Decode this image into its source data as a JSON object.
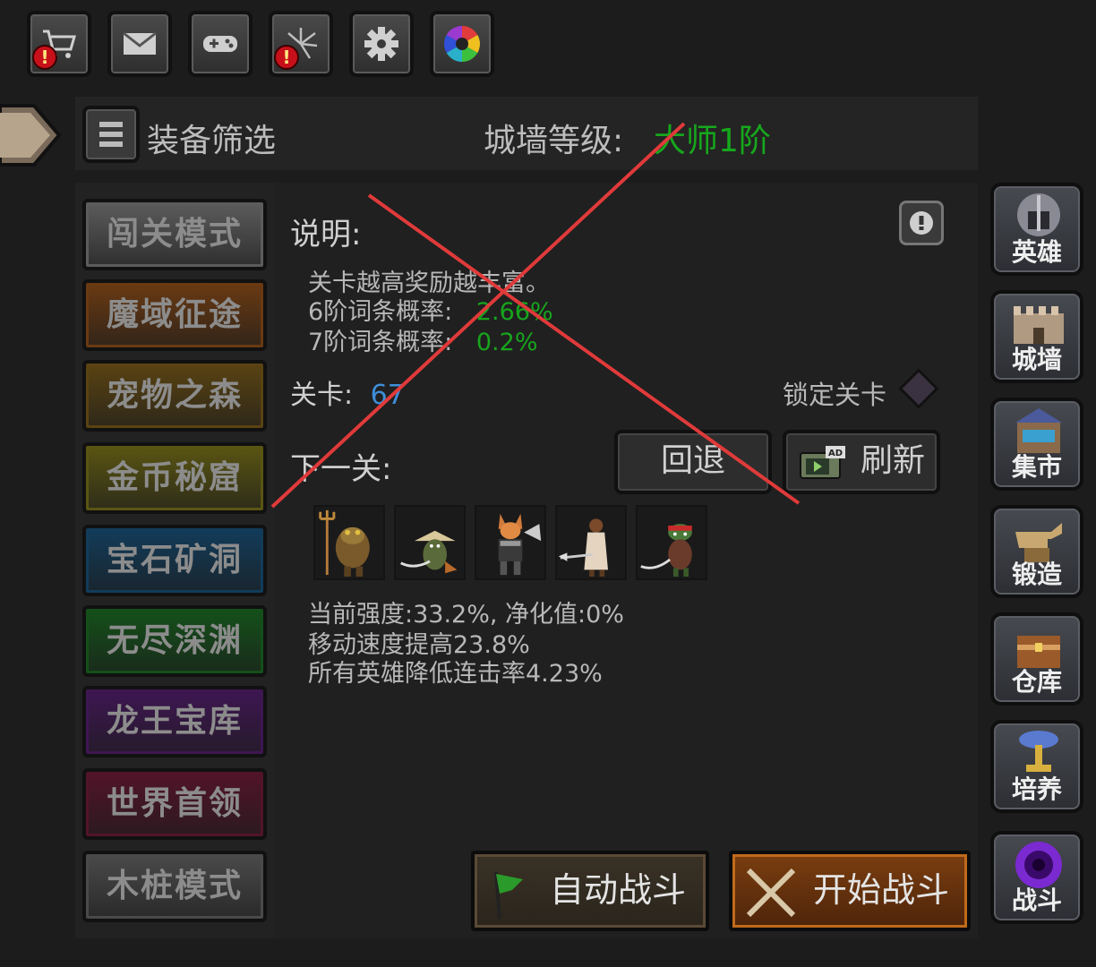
{
  "toolbar": {
    "icons": [
      "cart-icon",
      "mail-icon",
      "gamepad-icon",
      "fireworks-icon",
      "gear-icon",
      "color-wheel-icon"
    ],
    "alert_badge": "!"
  },
  "filter": {
    "label": "装备筛选",
    "wall_level_label": "城墙等级:",
    "wall_level_value": "大师1阶"
  },
  "modes": [
    {
      "label": "闯关模式",
      "color": "#5c5c5c"
    },
    {
      "label": "魔域征途",
      "color": "#6a3a12"
    },
    {
      "label": "宠物之森",
      "color": "#5a4312"
    },
    {
      "label": "金币秘窟",
      "color": "#5a5512"
    },
    {
      "label": "宝石矿洞",
      "color": "#123c5a"
    },
    {
      "label": "无尽深渊",
      "color": "#14501a"
    },
    {
      "label": "龙王宝库",
      "color": "#3e1652"
    },
    {
      "label": "世界首领",
      "color": "#521428"
    },
    {
      "label": "木桩模式",
      "color": "#4a4a4a"
    }
  ],
  "main": {
    "desc_title": "说明:",
    "desc_line1": "关卡越高奖励越丰富。",
    "prob6_label": "6阶词条概率:",
    "prob6_value": "2.66%",
    "prob7_label": "7阶词条概率:",
    "prob7_value": "0.2%",
    "stage_label": "关卡:",
    "stage_value": "67",
    "lock_label": "锁定关卡",
    "next_label": "下一关:",
    "back_button": "回退",
    "refresh_button": "刷新",
    "ad_badge": "AD",
    "stats_line1": "当前强度:33.2%, 净化值:0%",
    "stats_line2": "移动速度提高23.8%",
    "stats_line3": "所有英雄降低连击率4.23%",
    "enemies": [
      "frog-trident-enemy",
      "frog-straw-hat-enemy",
      "fox-warrior-enemy",
      "weasel-spear-enemy",
      "frog-red-bandana-enemy"
    ]
  },
  "battle": {
    "auto_label": "自动战斗",
    "start_label": "开始战斗"
  },
  "nav": [
    {
      "label": "英雄",
      "icon": "helmet-icon"
    },
    {
      "label": "城墙",
      "icon": "wall-icon"
    },
    {
      "label": "集市",
      "icon": "market-icon"
    },
    {
      "label": "锻造",
      "icon": "anvil-icon"
    },
    {
      "label": "仓库",
      "icon": "chest-icon"
    },
    {
      "label": "培养",
      "icon": "chalice-icon"
    },
    {
      "label": "战斗",
      "icon": "portal-icon"
    }
  ],
  "colors": {
    "green_text": "#17a51c",
    "blue_text": "#3e8ed8",
    "cross_mark": "#e03a3a"
  }
}
